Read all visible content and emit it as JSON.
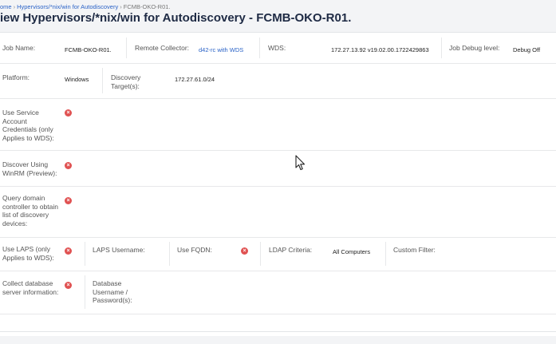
{
  "breadcrumb": {
    "home": "ome",
    "parent": "Hypervisors/*nix/win for Autodiscovery",
    "current": "FCMB-OKO-R01."
  },
  "page_title": "iew Hypervisors/*nix/win for Autodiscovery - FCMB-OKO-R01.",
  "fields": {
    "job_name_label": "Job Name:",
    "job_name_value": "FCMB-OKO-R01.",
    "remote_collector_label": "Remote Collector:",
    "remote_collector_value": "d42-rc with WDS",
    "wds_label": "WDS:",
    "wds_value": "172.27.13.92 v19.02.00.1722429863",
    "job_debug_label": "Job Debug level:",
    "job_debug_value": "Debug Off",
    "platform_label": "Platform:",
    "platform_value": "Windows",
    "discovery_targets_label": "Discovery Target(s):",
    "discovery_targets_value": "172.27.61.0/24",
    "use_service_account_label": "Use Service Account Credentials (only Applies to WDS):",
    "discover_winrm_label": "Discover Using WinRM (Preview):",
    "query_domain_label": "Query domain controller to obtain list of discovery devices:",
    "use_laps_label": "Use LAPS (only Applies to WDS):",
    "laps_username_label": "LAPS Username:",
    "use_fqdn_label": "Use FQDN:",
    "ldap_criteria_label": "LDAP Criteria:",
    "ldap_criteria_value": "All Computers",
    "custom_filter_label": "Custom Filter:",
    "collect_db_label": "Collect database server information:",
    "db_username_label": "Database Username / Password(s):"
  },
  "icons": {
    "false_icon": "x-circle-icon",
    "false_color": "#e05252",
    "cursor": "mouse-pointer-icon"
  }
}
